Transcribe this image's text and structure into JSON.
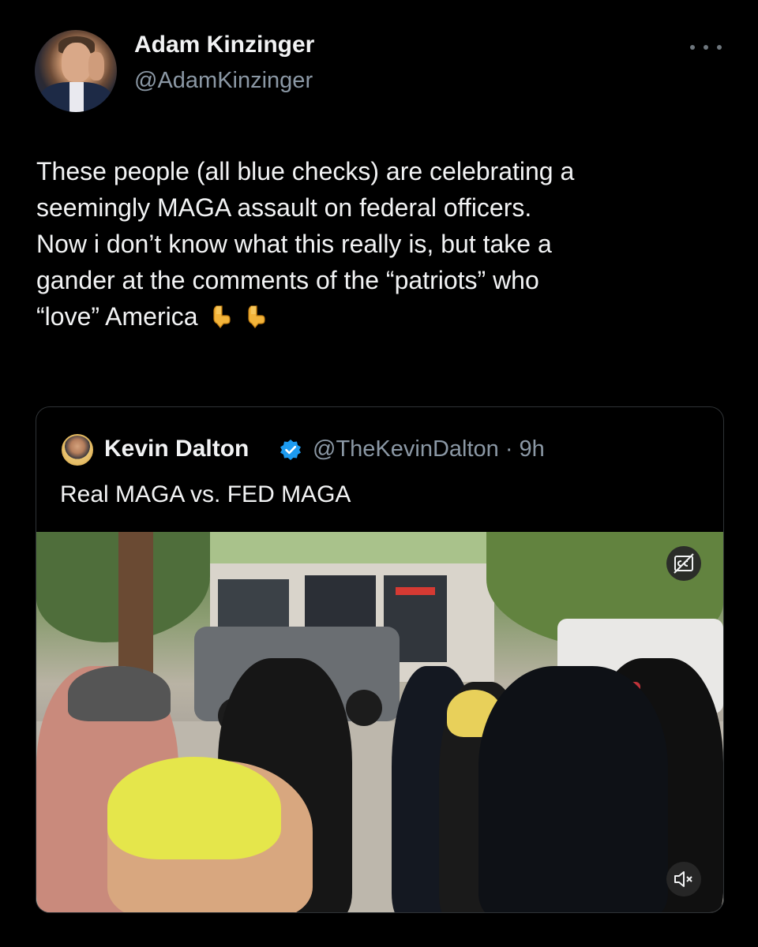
{
  "tweet": {
    "author": {
      "name": "Adam Kinzinger",
      "handle": "@AdamKinzinger"
    },
    "text": "These people (all blue checks) are celebrating a\nseemingly MAGA assault on federal officers.\nNow i don’t know what this really is, but take a\ngander at the comments of the “patriots” who\n“love” America",
    "emoji": [
      "pointing-down-icon",
      "pointing-down-icon"
    ]
  },
  "quote": {
    "author": {
      "name": "Kevin Dalton",
      "handle": "@TheKevinDalton · 9h",
      "verified": true
    },
    "text": "Real MAGA vs. FED MAGA"
  },
  "video": {
    "controls": [
      "captions-icon",
      "mute-icon"
    ]
  },
  "colors": {
    "background": "#000000",
    "text": "#f2f3f4",
    "muted_text": "#8b98a5",
    "verified_blue": "#1d9bf0",
    "border": "#2f3336"
  }
}
